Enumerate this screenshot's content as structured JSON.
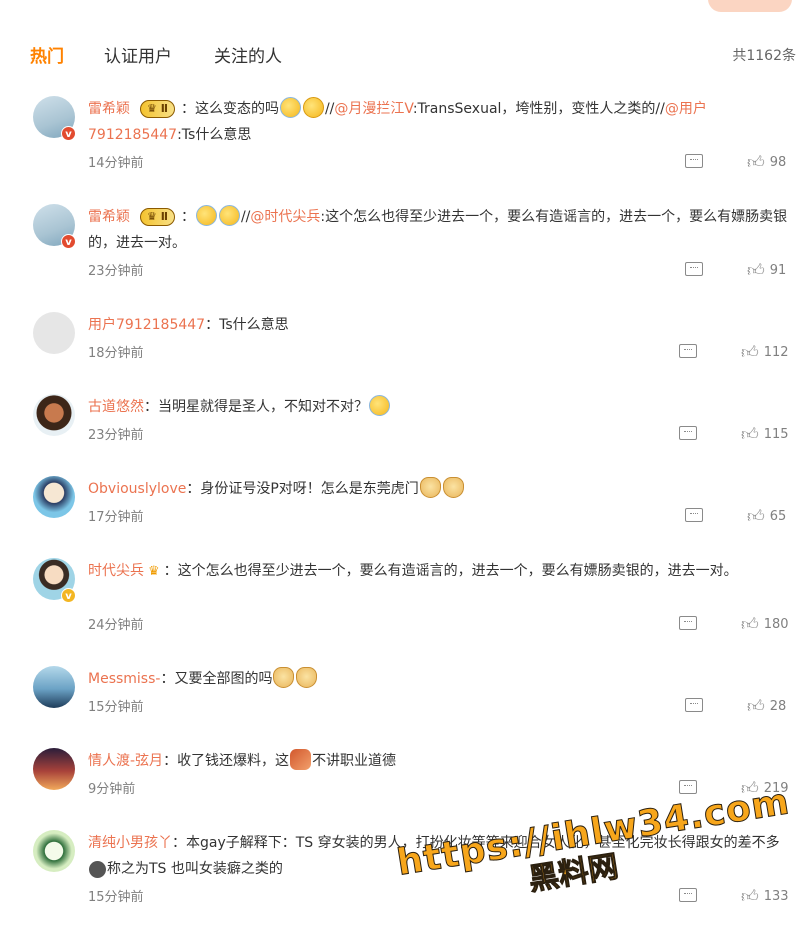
{
  "tabs": {
    "hot": "热门",
    "verified": "认证用户",
    "following": "关注的人"
  },
  "total_count": "共1162条",
  "comments": [
    {
      "user": "雷希颖",
      "badge": "Ⅱ",
      "sep": "：",
      "text_a": "这么变态的吗",
      "text_b": "//",
      "mention1": "@月漫拦江V",
      "text_c": ":TransSexual，垮性别，变性人之类的//",
      "mention2": "@用户7912185447",
      "text_d": ":Ts什么意思",
      "time": "14分钟前",
      "likes": "98"
    },
    {
      "user": "雷希颖",
      "badge": "Ⅱ",
      "sep": "：",
      "text_a": "//",
      "mention1": "@时代尖兵",
      "text_b": ":这个怎么也得至少进去一个，要么有造谣言的，进去一个，要么有嫖肠卖银的，进去一对。",
      "time": "23分钟前",
      "likes": "91"
    },
    {
      "user": "用户7912185447",
      "sep": "：",
      "text": "Ts什么意思",
      "time": "18分钟前",
      "likes": "112"
    },
    {
      "user": "古道悠然",
      "sep": "：",
      "text": "当明星就得是圣人，不知对不对？",
      "time": "23分钟前",
      "likes": "115"
    },
    {
      "user": "Obviouslylove",
      "sep": "：",
      "text": "身份证号没P对呀！怎么是东莞虎门",
      "time": "17分钟前",
      "likes": "65"
    },
    {
      "user": "时代尖兵",
      "sep": "：",
      "text": "这个怎么也得至少进去一个，要么有造谣言的，进去一个，要么有嫖肠卖银的，进去一对。",
      "time": "24分钟前",
      "likes": "180"
    },
    {
      "user": "Messmiss-",
      "sep": "：",
      "text": "又要全部图的吗",
      "time": "15分钟前",
      "likes": "28"
    },
    {
      "user": "情人渡-弦月",
      "sep": "：",
      "text_a": "收了钱还爆料，这",
      "text_b": "不讲职业道德",
      "time": "9分钟前",
      "likes": "219"
    },
    {
      "user": "清纯小男孩丫",
      "sep": "：",
      "text_a": "本gay子解释下：TS 穿女装的男人，打扮化妆等等来迎合女人化，甚至化完妆长得跟女的差不多",
      "text_b": "称之为TS 也叫女装癖之类的",
      "time": "15分钟前",
      "likes": "133"
    }
  ],
  "watermark": {
    "line1": "https://ihlw34.com",
    "line2": "黑料网"
  }
}
